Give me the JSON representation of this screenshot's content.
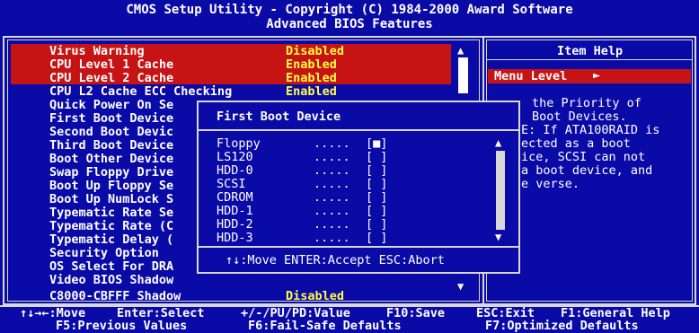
{
  "header": {
    "title": "CMOS Setup Utility - Copyright (C) 1984-2000 Award Software",
    "subtitle": "Advanced BIOS Features"
  },
  "settings": [
    {
      "label": "Virus Warning",
      "value": "Disabled",
      "highlighted": true
    },
    {
      "label": "CPU Level 1 Cache",
      "value": "Enabled",
      "highlighted": true
    },
    {
      "label": "CPU Level 2 Cache",
      "value": "Enabled",
      "highlighted": true
    },
    {
      "label": "CPU L2 Cache ECC Checking",
      "value": "Enabled",
      "highlighted": false
    },
    {
      "label": "Quick Power On Se",
      "value": "",
      "highlighted": false
    },
    {
      "label": "First Boot Device",
      "value": "",
      "highlighted": false
    },
    {
      "label": "Second Boot Devic",
      "value": "",
      "highlighted": false
    },
    {
      "label": "Third Boot Device",
      "value": "",
      "highlighted": false
    },
    {
      "label": "Boot Other Device",
      "value": "",
      "highlighted": false
    },
    {
      "label": "Swap Floppy Drive",
      "value": "",
      "highlighted": false
    },
    {
      "label": "Boot Up Floppy Se",
      "value": "",
      "highlighted": false
    },
    {
      "label": "Boot Up NumLock S",
      "value": "",
      "highlighted": false
    },
    {
      "label": "Typematic Rate Se",
      "value": "",
      "highlighted": false
    },
    {
      "label": "Typematic Rate (C",
      "value": "",
      "highlighted": false
    },
    {
      "label": "Typematic Delay (",
      "value": "",
      "highlighted": false
    },
    {
      "label": "Security Option",
      "value": "",
      "highlighted": false
    },
    {
      "label": "OS Select For DRA",
      "value": "",
      "highlighted": false
    },
    {
      "label": "Video BIOS Shadow",
      "value": "",
      "highlighted": false
    },
    {
      "label": "C8000-CBFFF Shadow",
      "value": "Disabled",
      "highlighted": false
    }
  ],
  "scroll": {
    "up_arrow": "▲",
    "down_arrow": "▼"
  },
  "help": {
    "title": "Item Help",
    "menu_level": "Menu Level",
    "menu_arrow": "►",
    "lines": [
      "the Priority of",
      "Boot Devices.",
      "E: If ATA100RAID is",
      "ected as a boot",
      "ice, SCSI can not",
      "a boot device, and",
      "e verse."
    ]
  },
  "popup": {
    "title": "First Boot Device",
    "options": [
      {
        "name": "Floppy",
        "dots": ".....",
        "mark": "[■]"
      },
      {
        "name": "LS120",
        "dots": ".....",
        "mark": "[ ]"
      },
      {
        "name": "HDD-0",
        "dots": ".....",
        "mark": "[ ]"
      },
      {
        "name": "SCSI",
        "dots": ".....",
        "mark": "[ ]"
      },
      {
        "name": "CDROM",
        "dots": ".....",
        "mark": "[ ]"
      },
      {
        "name": "HDD-1",
        "dots": ".....",
        "mark": "[ ]"
      },
      {
        "name": "HDD-2",
        "dots": ".....",
        "mark": "[ ]"
      },
      {
        "name": "HDD-3",
        "dots": ".....",
        "mark": "[ ]"
      }
    ],
    "up_arrow": "▲",
    "down_arrow": "▼",
    "footer": "↑↓:Move ENTER:Accept ESC:Abort"
  },
  "footer": {
    "line1": [
      {
        "key": "↑↓→←:Move",
        "text": ""
      },
      {
        "key": "Enter:Select",
        "text": ""
      },
      {
        "key": "+/-/PU/PD:Value",
        "text": ""
      },
      {
        "key": "F10:Save",
        "text": ""
      },
      {
        "key": "ESC:Exit",
        "text": ""
      },
      {
        "key": "F1:General Help",
        "text": ""
      }
    ],
    "line2": [
      {
        "key": "F5:Previous Values",
        "text": ""
      },
      {
        "key": "F6:Fail-Safe Defaults",
        "text": ""
      },
      {
        "key": "F7:Optimized Defaults",
        "text": ""
      }
    ]
  },
  "colors": {
    "background": "#0a0aa6",
    "highlight_red": "#c61414",
    "value_yellow": "#ffff40",
    "frame": "#d8d8d8"
  }
}
